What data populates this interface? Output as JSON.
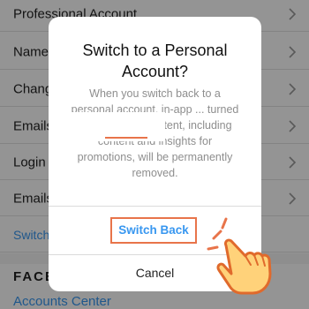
{
  "settings": {
    "rows": [
      {
        "label": "Professional Account"
      },
      {
        "label": "Name"
      },
      {
        "label": "Change"
      },
      {
        "label": "Emails"
      },
      {
        "label": "Login"
      },
      {
        "label": "Emails"
      }
    ],
    "switch_link": "Switch",
    "section_heading": "FACE",
    "accounts_center": "Accounts Center"
  },
  "dialog": {
    "title": "Switch to a Personal Account?",
    "message": "When you switch back to a personal account, in-app ... turned off and ... our content, including content and insights for promotions, will be permanently removed.",
    "primary_button": "Switch Back",
    "cancel_button": "Cancel"
  },
  "colors": {
    "accent": "#3897f0",
    "highlight": "#e8744a",
    "overlay": "rgba(0,0,0,0.42)"
  },
  "icons": [
    "chevron-right-icon",
    "pointing-hand-icon"
  ]
}
